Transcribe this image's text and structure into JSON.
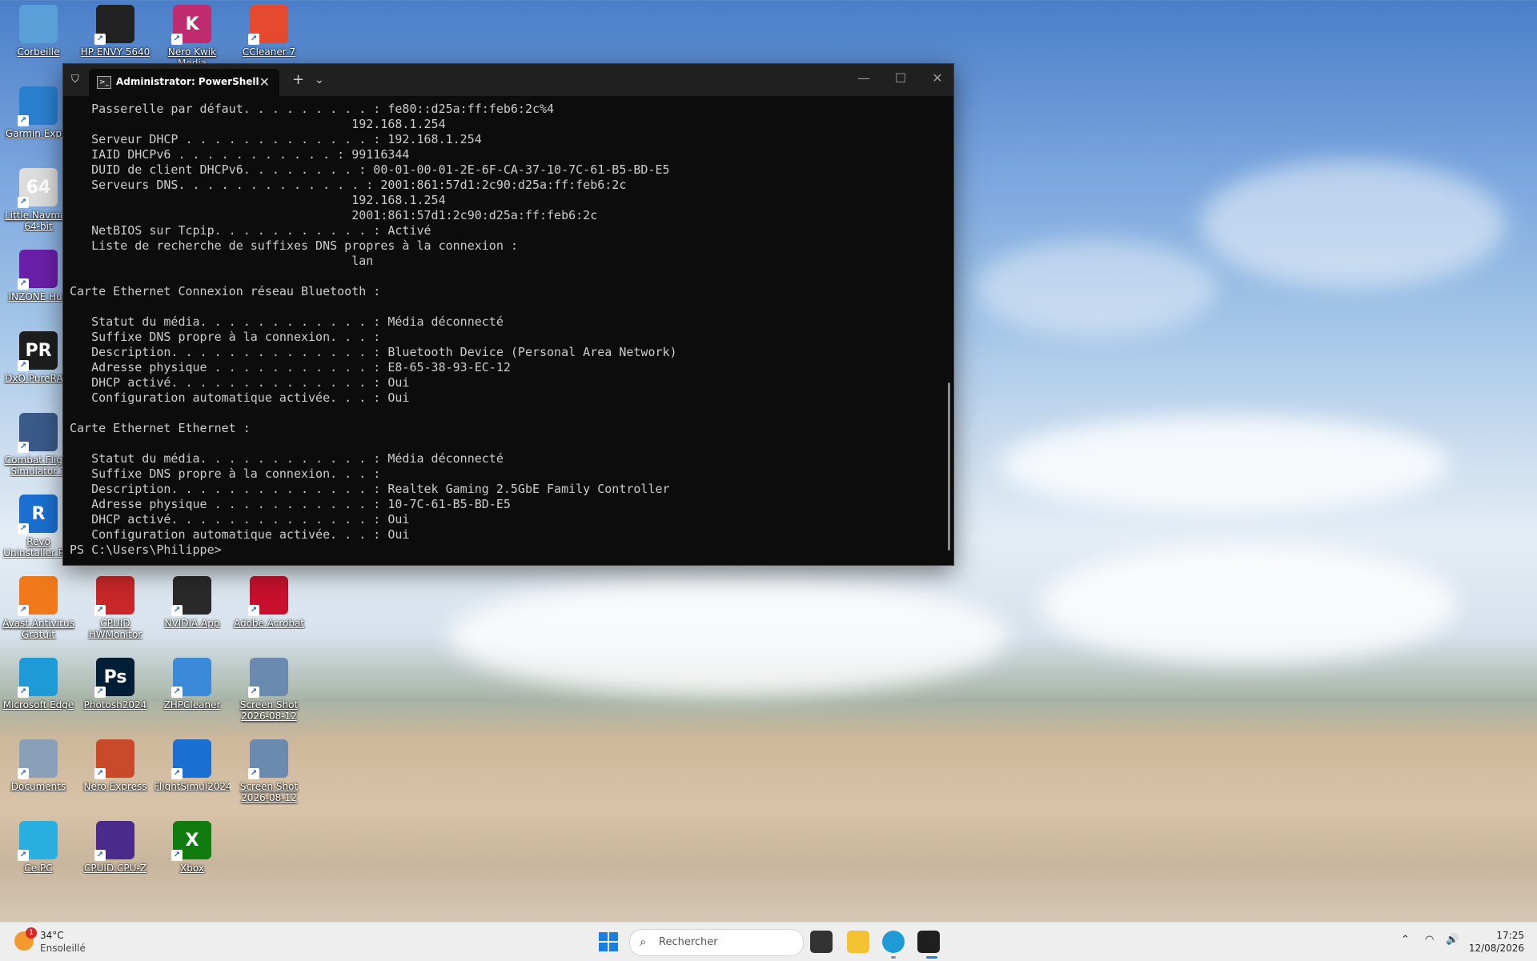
{
  "desktop_icons": [
    {
      "label": "Corbeille",
      "icon": "recycle-bin-icon",
      "color": "#5aa0d8"
    },
    {
      "label": "HP ENVY 5640",
      "icon": "printer-icon",
      "color": "#222222"
    },
    {
      "label": "Nero Kwik Media",
      "icon": "nero-kwik-icon",
      "color": "#c02a6e",
      "glyph": "K"
    },
    {
      "label": "CCleaner 7",
      "icon": "ccleaner-icon",
      "color": "#e64a2e"
    },
    {
      "label": "Garmin Expre",
      "icon": "garmin-globe-icon",
      "color": "#2a7fd0"
    },
    {
      "label": "Little Navmap 64-bit",
      "icon": "navmap-icon",
      "color": "#dddddd",
      "glyph": "64"
    },
    {
      "label": "INZONE Hub",
      "icon": "inzone-icon",
      "color": "#6a1fa8"
    },
    {
      "label": "DxO PureRAW",
      "icon": "dxo-icon",
      "color": "#1e1e1e",
      "glyph": "PR"
    },
    {
      "label": "Combat Flight Simulator 3",
      "icon": "cfs3-icon",
      "color": "#3a5a8a"
    },
    {
      "label": "Revo Uninstaller Pro",
      "icon": "revo-icon",
      "color": "#1a6fd0",
      "glyph": "R"
    },
    {
      "label": "Avast Antivirus Gratuit",
      "icon": "avast-icon",
      "color": "#f07a1a"
    },
    {
      "label": "CPUID HWMonitor",
      "icon": "hwmonitor-icon",
      "color": "#c8282a"
    },
    {
      "label": "NVIDIA App",
      "icon": "nvidia-icon",
      "color": "#2a2a2a"
    },
    {
      "label": "Adobe Acrobat",
      "icon": "acrobat-icon",
      "color": "#c8102e"
    },
    {
      "label": "Microsoft Edge",
      "icon": "edge-icon",
      "color": "#1e9bd7"
    },
    {
      "label": "Photosh2024",
      "icon": "photoshop-icon",
      "color": "#001e36",
      "glyph": "Ps"
    },
    {
      "label": "ZHPCleaner",
      "icon": "zhpcleaner-icon",
      "color": "#3a8ad8"
    },
    {
      "label": "Screen Shot 2026-08-12 at...",
      "icon": "screenshot-thumb-icon",
      "color": "#6a8ab0"
    },
    {
      "label": "Documents",
      "icon": "documents-folder-icon",
      "color": "#8aa0b8"
    },
    {
      "label": "Nero Express",
      "icon": "nero-express-icon",
      "color": "#c84a2a"
    },
    {
      "label": "FlightSimul2024",
      "icon": "flightsim-icon",
      "color": "#1a6fd0"
    },
    {
      "label": "Screen Shot 2026-08-12 at...",
      "icon": "screenshot-thumb-icon",
      "color": "#6a8ab0"
    },
    {
      "label": "Ce PC",
      "icon": "this-pc-icon",
      "color": "#2ab0e0"
    },
    {
      "label": "CPUID CPU-Z",
      "icon": "cpuz-icon",
      "color": "#4a2a8a"
    },
    {
      "label": "Xbox",
      "icon": "xbox-icon",
      "color": "#107c10",
      "glyph": "X"
    }
  ],
  "terminal": {
    "tab_title": "Administrator: PowerShell",
    "new_tab": "+",
    "dropdown": "⌄",
    "lines": [
      "   Passerelle par défaut. . . . . . . . . : fe80::d25a:ff:feb6:2c%4",
      "                                       192.168.1.254",
      "   Serveur DHCP . . . . . . . . . . . . . : 192.168.1.254",
      "   IAID DHCPv6 . . . . . . . . . . . : 99116344",
      "   DUID de client DHCPv6. . . . . . . . : 00-01-00-01-2E-6F-CA-37-10-7C-61-B5-BD-E5",
      "   Serveurs DNS. . . . . . . . . . . . . : 2001:861:57d1:2c90:d25a:ff:feb6:2c",
      "                                       192.168.1.254",
      "                                       2001:861:57d1:2c90:d25a:ff:feb6:2c",
      "   NetBIOS sur Tcpip. . . . . . . . . . . : Activé",
      "   Liste de recherche de suffixes DNS propres à la connexion :",
      "                                       lan",
      "",
      "Carte Ethernet Connexion réseau Bluetooth :",
      "",
      "   Statut du média. . . . . . . . . . . . : Média déconnecté",
      "   Suffixe DNS propre à la connexion. . . :",
      "   Description. . . . . . . . . . . . . . : Bluetooth Device (Personal Area Network)",
      "   Adresse physique . . . . . . . . . . . : E8-65-38-93-EC-12",
      "   DHCP activé. . . . . . . . . . . . . . : Oui",
      "   Configuration automatique activée. . . : Oui",
      "",
      "Carte Ethernet Ethernet :",
      "",
      "   Statut du média. . . . . . . . . . . . : Média déconnecté",
      "   Suffixe DNS propre à la connexion. . . :",
      "   Description. . . . . . . . . . . . . . : Realtek Gaming 2.5GbE Family Controller",
      "   Adresse physique . . . . . . . . . . . : 10-7C-61-B5-BD-E5",
      "   DHCP activé. . . . . . . . . . . . . . : Oui",
      "   Configuration automatique activée. . . : Oui",
      "PS C:\\Users\\Philippe>"
    ]
  },
  "taskbar": {
    "weather_temp": "34°C",
    "weather_condition": "Ensoleillé",
    "weather_badge": "1",
    "search_placeholder": "Rechercher",
    "time": "17:25",
    "date": "12/08/2026"
  }
}
